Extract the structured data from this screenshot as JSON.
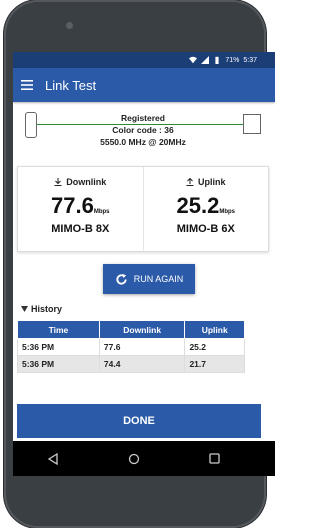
{
  "status_bar": {
    "battery_percent": "71%",
    "time": "5:37"
  },
  "app_bar": {
    "title": "Link Test"
  },
  "link": {
    "status": "Registered",
    "color_code": "Color code : 36",
    "frequency": "5550.0 MHz @ 20MHz"
  },
  "downlink": {
    "label": "Downlink",
    "value": "77.6",
    "unit": "Mbps",
    "mode": "MIMO-B 8X"
  },
  "uplink": {
    "label": "Uplink",
    "value": "25.2",
    "unit": "Mbps",
    "mode": "MIMO-B 6X"
  },
  "run_again_label": "RUN AGAIN",
  "history": {
    "label": "History",
    "columns": [
      "Time",
      "Downlink",
      "Uplink"
    ],
    "rows": [
      [
        "5:36 PM",
        "77.6",
        "25.2"
      ],
      [
        "5:36 PM",
        "74.4",
        "21.7"
      ]
    ]
  },
  "done_label": "DONE",
  "colors": {
    "primary": "#2a5aa8",
    "status_bar": "#1b3e77",
    "link_line": "#2c8a3c"
  }
}
